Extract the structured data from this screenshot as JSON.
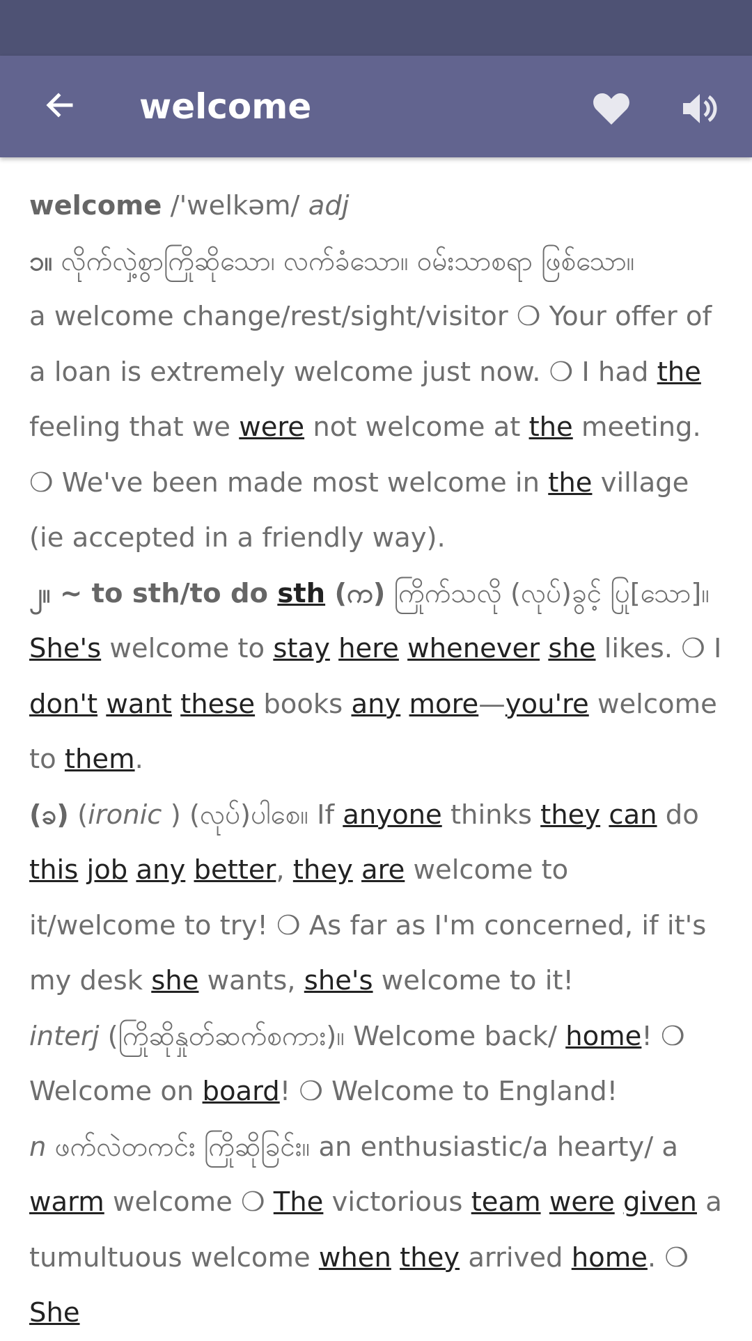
{
  "status_bar": {},
  "app_bar": {
    "title": "welcome",
    "icons": {
      "back": "back-arrow-icon",
      "favorite": "heart-icon",
      "speak": "speaker-icon"
    }
  },
  "entry": {
    "headword": "welcome",
    "pronunciation": " /'welkəm/ ",
    "pos": "adj",
    "sense1": {
      "num": "၁။",
      "burmese": " လိုက်လှဲ့စွာကြိုဆိုသော၊ လက်ခံသော။ ဝမ်းသာစရာ ဖြစ်သော။",
      "examples": [
        {
          "t": "a welcome change/rest/sight/visitor ❍ Your offer of a loan is extremely welcome just now. ❍ I had "
        },
        {
          "u": "the"
        },
        {
          "t": " feeling that we "
        },
        {
          "u": "were"
        },
        {
          "t": " not welcome at "
        },
        {
          "u": "the"
        },
        {
          "t": " meeting. ❍ We've been made most welcome in "
        },
        {
          "u": "the"
        },
        {
          "t": " village (ie accepted in a friendly way)."
        }
      ]
    },
    "sense2": {
      "lead": "၂။ ~ to sth/to do ",
      "lead_link": "sth",
      "lead_sub": " (က)",
      "burmese": " ကြိုက်သလို (လုပ်)ခွင့် ပြု[သော]။ ",
      "ex": [
        {
          "u": "She's"
        },
        {
          "t": " welcome to "
        },
        {
          "u": "stay"
        },
        {
          "t": " "
        },
        {
          "u": "here"
        },
        {
          "t": " "
        },
        {
          "u": "whenever"
        },
        {
          "t": " "
        },
        {
          "u": "she"
        },
        {
          "t": " likes. ❍ I "
        },
        {
          "u": "don't"
        },
        {
          "t": " "
        },
        {
          "u": "want"
        },
        {
          "t": " "
        },
        {
          "u": "these"
        },
        {
          "t": " books "
        },
        {
          "u": "any"
        },
        {
          "t": " "
        },
        {
          "u": "more"
        },
        {
          "t": "—"
        },
        {
          "u": "you're"
        },
        {
          "t": " welcome to "
        },
        {
          "u": "them"
        },
        {
          "t": "."
        }
      ]
    },
    "sense2b": {
      "label": "(ခ)",
      "ironic": "ironic",
      "burmese": " (လုပ်)ပါစေ။ If ",
      "ex": [
        {
          "u": "anyone"
        },
        {
          "t": " thinks "
        },
        {
          "u": "they"
        },
        {
          "t": " "
        },
        {
          "u": "can"
        },
        {
          "t": " do "
        },
        {
          "u": "this"
        },
        {
          "t": " "
        },
        {
          "u": "job"
        },
        {
          "t": " "
        },
        {
          "u": "any"
        },
        {
          "t": " "
        },
        {
          "u": "better"
        },
        {
          "t": ", "
        },
        {
          "u": "they"
        },
        {
          "t": " "
        },
        {
          "u": "are"
        },
        {
          "t": " welcome to it/welcome to try! ❍ As far as I'm concerned, if it's my desk "
        },
        {
          "u": "she"
        },
        {
          "t": " wants, "
        },
        {
          "u": "she's"
        },
        {
          "t": " welcome to it!"
        }
      ]
    },
    "interj": {
      "label": "interj",
      "ex": [
        {
          "t": " (ကြိုဆိုနှုတ်ဆက်စကား)။ Welcome back/ "
        },
        {
          "u": "home"
        },
        {
          "t": "! ❍ Welcome on "
        },
        {
          "u": "board"
        },
        {
          "t": "! ❍ Welcome to England!"
        }
      ]
    },
    "noun": {
      "label": "n",
      "ex": [
        {
          "t": " ဖက်လဲတကင်း ကြိုဆိုခြင်း။ an enthusiastic/a hearty/ a "
        },
        {
          "u": "warm"
        },
        {
          "t": " welcome ❍ "
        },
        {
          "u": "The"
        },
        {
          "t": " victorious "
        },
        {
          "u": "team"
        },
        {
          "t": " "
        },
        {
          "u": "were"
        },
        {
          "t": " "
        },
        {
          "u": "given"
        },
        {
          "t": " a tumultuous welcome "
        },
        {
          "u": "when"
        },
        {
          "t": " "
        },
        {
          "u": "they"
        },
        {
          "t": " arrived "
        },
        {
          "u": "home"
        },
        {
          "t": ". ❍ "
        },
        {
          "u": "She"
        }
      ]
    }
  }
}
